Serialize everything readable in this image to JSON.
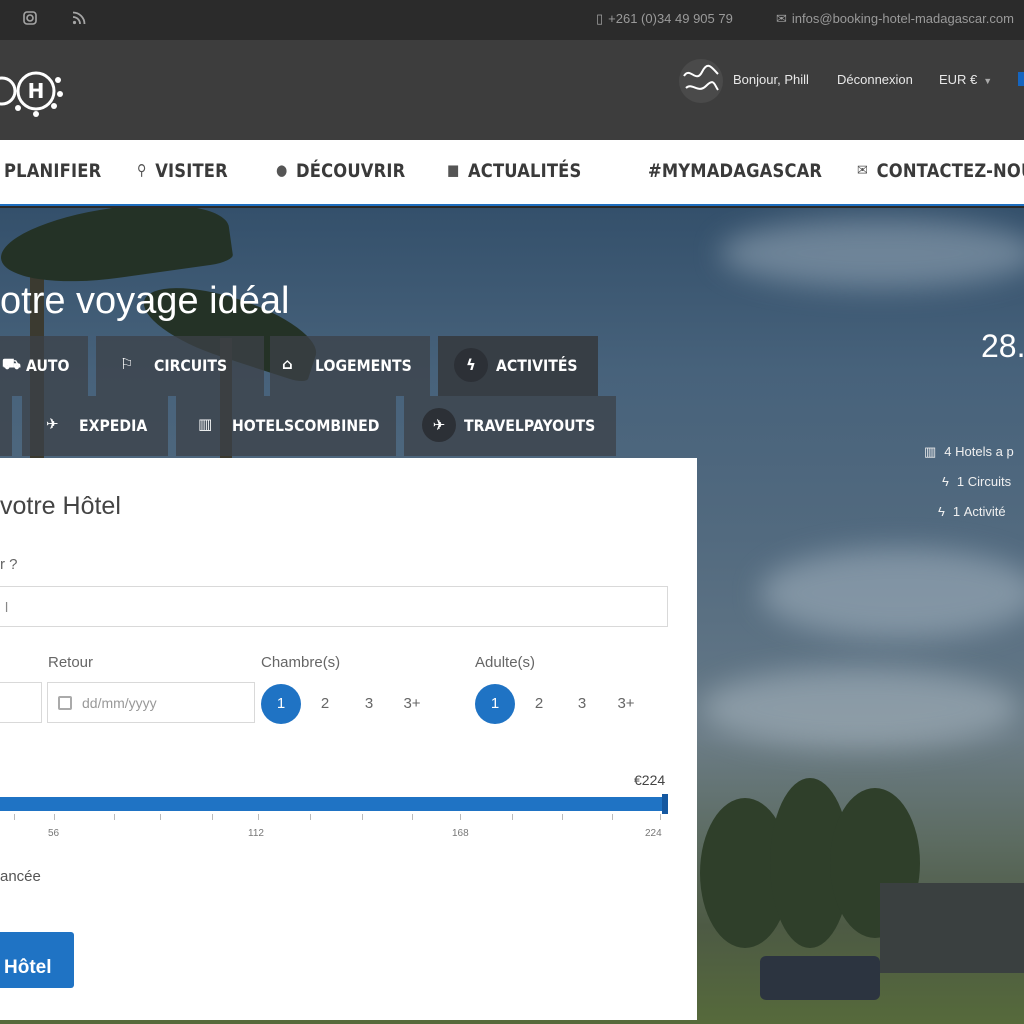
{
  "topbar": {
    "social_icons": [
      "instagram-icon",
      "rss-icon"
    ],
    "phone": "+261 (0)34 49 905 79",
    "email": "infos@booking-hotel-madagascar.com"
  },
  "header": {
    "greeting": "Bonjour, Phill",
    "logout": "Déconnexion",
    "currency": "EUR €"
  },
  "nav": {
    "items": [
      {
        "label": "PLANIFIER",
        "icon": ""
      },
      {
        "label": "VISITER",
        "icon": "map-pin-icon"
      },
      {
        "label": "DÉCOUVRIR",
        "icon": "globe-icon"
      },
      {
        "label": "ACTUALITÉS",
        "icon": "edit-icon"
      },
      {
        "label": "#MYMADAGASCAR",
        "icon": ""
      },
      {
        "label": "CONTACTEZ-NOU",
        "icon": "envelope-icon"
      }
    ]
  },
  "hero": {
    "title": "otre voyage idéal",
    "tabs_row1": [
      {
        "label": "AUTO",
        "icon": "car-icon"
      },
      {
        "label": "CIRCUITS",
        "icon": "flag-icon"
      },
      {
        "label": "LOGEMENTS",
        "icon": "home-icon"
      },
      {
        "label": "ACTIVITÉS",
        "icon": "bolt-icon"
      }
    ],
    "tabs_row2": [
      {
        "label": "EXPEDIA",
        "icon": "plane-icon"
      },
      {
        "label": "HOTELSCOMBINED",
        "icon": "building-icon"
      },
      {
        "label": "TRAVELPAYOUTS",
        "icon": "plane-icon"
      }
    ],
    "stats": {
      "big": "28.",
      "hotels": "4 Hotels a p",
      "circuits": "1 Circuits",
      "activities": "1 Activité"
    }
  },
  "search": {
    "title": "votre Hôtel",
    "question": "r ?",
    "destination_value": "l",
    "return_label": "Retour",
    "return_placeholder": "dd/mm/yyyy",
    "rooms_label": "Chambre(s)",
    "adults_label": "Adulte(s)",
    "options": [
      "1",
      "2",
      "3",
      "3+"
    ],
    "rooms_selected": "1",
    "adults_selected": "1",
    "price": {
      "max_label": "€224",
      "ticks": [
        "56",
        "112",
        "168",
        "224"
      ],
      "value": 224,
      "max": 224
    },
    "advanced": "ancée",
    "button": "Hôtel"
  },
  "colors": {
    "accent": "#1f73c4",
    "topbar": "#2b2b2b",
    "header": "#3d3d3d",
    "nav_border": "#1f6fbf"
  }
}
